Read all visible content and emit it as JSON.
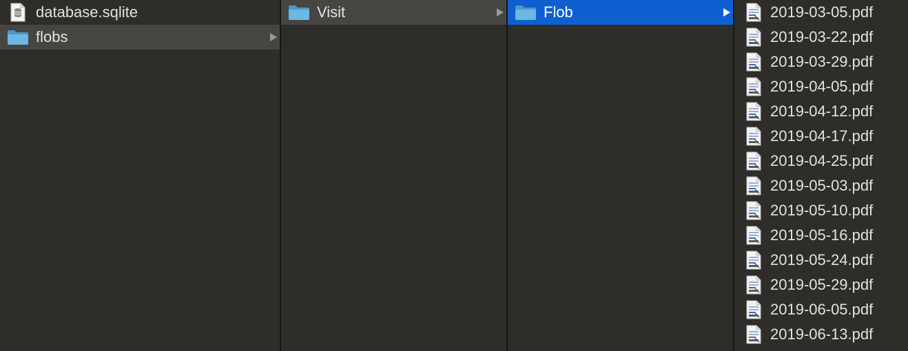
{
  "columns": [
    {
      "items": [
        {
          "label": "database.sqlite",
          "icon": "sqlite-file-icon",
          "type": "file",
          "state": "normal"
        },
        {
          "label": "flobs",
          "icon": "folder-icon",
          "type": "folder",
          "state": "selected-inactive"
        }
      ]
    },
    {
      "items": [
        {
          "label": "Visit",
          "icon": "folder-icon",
          "type": "folder",
          "state": "selected-inactive"
        }
      ]
    },
    {
      "items": [
        {
          "label": "Flob",
          "icon": "folder-icon",
          "type": "folder",
          "state": "selected-active"
        }
      ]
    },
    {
      "items": [
        {
          "label": "2019-03-05.pdf",
          "icon": "pdf-file-icon"
        },
        {
          "label": "2019-03-22.pdf",
          "icon": "pdf-file-icon"
        },
        {
          "label": "2019-03-29.pdf",
          "icon": "pdf-file-icon"
        },
        {
          "label": "2019-04-05.pdf",
          "icon": "pdf-file-icon"
        },
        {
          "label": "2019-04-12.pdf",
          "icon": "pdf-file-icon"
        },
        {
          "label": "2019-04-17.pdf",
          "icon": "pdf-file-icon"
        },
        {
          "label": "2019-04-25.pdf",
          "icon": "pdf-file-icon"
        },
        {
          "label": "2019-05-03.pdf",
          "icon": "pdf-file-icon"
        },
        {
          "label": "2019-05-10.pdf",
          "icon": "pdf-file-icon"
        },
        {
          "label": "2019-05-16.pdf",
          "icon": "pdf-file-icon"
        },
        {
          "label": "2019-05-24.pdf",
          "icon": "pdf-file-icon"
        },
        {
          "label": "2019-05-29.pdf",
          "icon": "pdf-file-icon"
        },
        {
          "label": "2019-06-05.pdf",
          "icon": "pdf-file-icon"
        },
        {
          "label": "2019-06-13.pdf",
          "icon": "pdf-file-icon"
        }
      ]
    }
  ],
  "colors": {
    "background": "#2e2d29",
    "selected_inactive": "#464542",
    "selected_active": "#0f5fd1",
    "folder": "#5ba6d6",
    "text": "#e3e2e0"
  }
}
